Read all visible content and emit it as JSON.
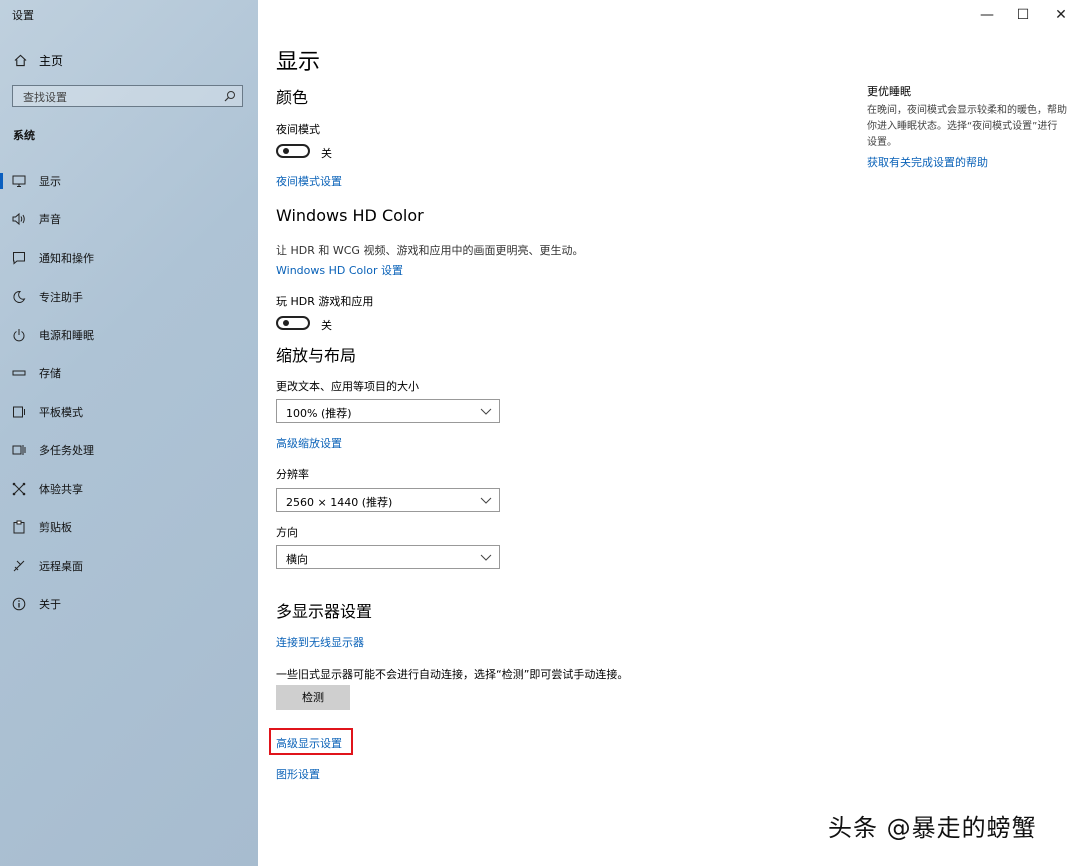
{
  "window": {
    "title": "设置"
  },
  "sidebar": {
    "home_label": "主页",
    "search_placeholder": "查找设置",
    "section_label": "系统",
    "items": [
      {
        "label": "显示",
        "icon": "monitor-icon"
      },
      {
        "label": "声音",
        "icon": "speaker-icon"
      },
      {
        "label": "通知和操作",
        "icon": "notification-icon"
      },
      {
        "label": "专注助手",
        "icon": "moon-icon"
      },
      {
        "label": "电源和睡眠",
        "icon": "power-icon"
      },
      {
        "label": "存储",
        "icon": "storage-icon"
      },
      {
        "label": "平板模式",
        "icon": "tablet-icon"
      },
      {
        "label": "多任务处理",
        "icon": "multitask-icon"
      },
      {
        "label": "体验共享",
        "icon": "share-icon"
      },
      {
        "label": "剪贴板",
        "icon": "clipboard-icon"
      },
      {
        "label": "远程桌面",
        "icon": "remote-icon"
      },
      {
        "label": "关于",
        "icon": "info-icon"
      }
    ],
    "active_item": "显示"
  },
  "window_controls": {
    "minimize": "—",
    "maximize": "☐",
    "close": "✕"
  },
  "main": {
    "page_title": "显示",
    "color_section": {
      "heading": "颜色",
      "night_mode_label": "夜间模式",
      "night_mode_state": "关",
      "night_mode_link": "夜间模式设置"
    },
    "hdr_section": {
      "heading": "Windows HD Color",
      "description": "让 HDR 和 WCG 视频、游戏和应用中的画面更明亮、更生动。",
      "link": "Windows HD Color 设置",
      "play_hdr_label": "玩 HDR 游戏和应用",
      "play_hdr_state": "关"
    },
    "scale_section": {
      "heading": "缩放与布局",
      "text_size_label": "更改文本、应用等项目的大小",
      "text_size_value": "100% (推荐)",
      "advanced_scaling_link": "高级缩放设置",
      "resolution_label": "分辨率",
      "resolution_value": "2560 × 1440 (推荐)",
      "orientation_label": "方向",
      "orientation_value": "横向"
    },
    "multi_display_section": {
      "heading": "多显示器设置",
      "wireless_link": "连接到无线显示器",
      "detect_description": "一些旧式显示器可能不会进行自动连接，选择“检测”即可尝试手动连接。",
      "detect_button": "检测",
      "advanced_display_link": "高级显示设置",
      "graphics_link": "图形设置"
    }
  },
  "right_panel": {
    "title": "更优睡眠",
    "description": "在晚间，夜间模式会显示较柔和的暖色，帮助你进入睡眠状态。选择“夜间模式设置”进行设置。",
    "link": "获取有关完成设置的帮助"
  },
  "watermark": "头条 @暴走的螃蟹",
  "colors": {
    "accent": "#0a62b8",
    "highlight": "#e0141b",
    "sidebar_bg": "#aec3d5"
  }
}
